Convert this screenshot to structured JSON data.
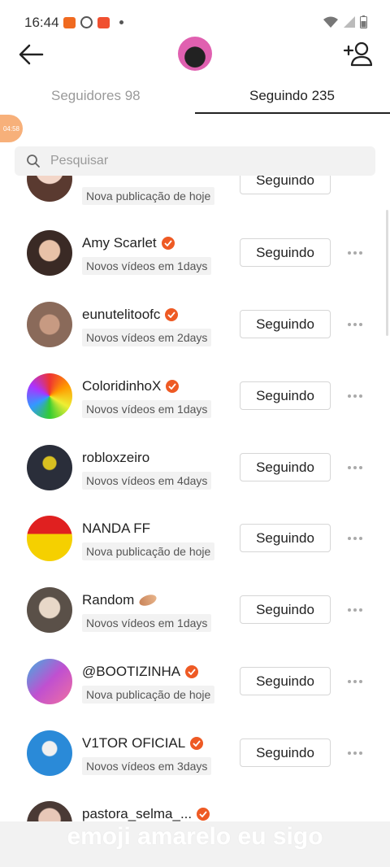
{
  "status_bar": {
    "time": "16:44"
  },
  "float_badge": "04:58",
  "tabs": {
    "followers": "Seguidores 98",
    "following": "Seguindo 235"
  },
  "search": {
    "placeholder": "Pesquisar"
  },
  "list": {
    "partial_top": {
      "sub": "Nova publicação de hoje",
      "button": "Seguindo"
    },
    "rows": [
      {
        "name": "Amy Scarlet",
        "verified": true,
        "sub": "Novos vídeos em 1days",
        "button": "Seguindo"
      },
      {
        "name": "eunutelitoofc",
        "verified": true,
        "sub": "Novos vídeos em 2days",
        "button": "Seguindo"
      },
      {
        "name": "ColoridinhoX",
        "verified": true,
        "sub": "Novos vídeos em 1days",
        "button": "Seguindo"
      },
      {
        "name": "robloxzeiro",
        "verified": false,
        "sub": "Novos vídeos em 4days",
        "button": "Seguindo"
      },
      {
        "name": "NANDA FF",
        "verified": false,
        "sub": "Nova publicação de hoje",
        "button": "Seguindo"
      },
      {
        "name": "Random",
        "verified": false,
        "sub": "Novos vídeos em 1days",
        "button": "Seguindo"
      },
      {
        "name": "@BOOTIZINHA",
        "verified": true,
        "sub": "Nova publicação de hoje",
        "button": "Seguindo"
      },
      {
        "name": "V1TOR OFICIAL",
        "verified": true,
        "sub": "Novos vídeos em 3days",
        "button": "Seguindo"
      }
    ],
    "partial_bottom": {
      "name": "pastora_selma_..."
    }
  },
  "caption": "emoji amarelo eu sigo",
  "colors": {
    "accent": "#ee5a24",
    "text": "#222222",
    "muted": "#9a9a9a"
  }
}
